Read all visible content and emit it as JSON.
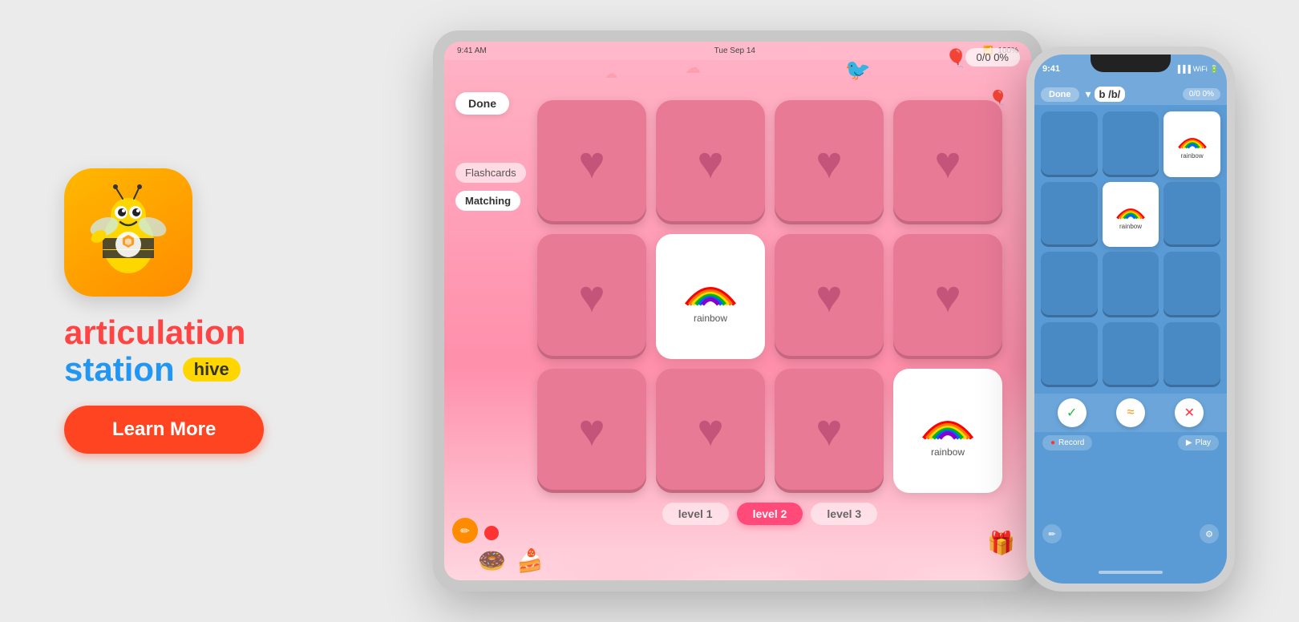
{
  "background_color": "#ebebeb",
  "left": {
    "app_icon_alt": "Articulation Station Hive App Icon",
    "title_line1": "articulation",
    "title_line2_word1": "station",
    "hive_label": "hive",
    "learn_more_label": "Learn More"
  },
  "tablet": {
    "status_bar": {
      "time": "9:41 AM",
      "date": "Tue Sep 14",
      "wifi": "WiFi",
      "battery": "100%"
    },
    "done_button": "Done",
    "flashcards_button": "Flashcards",
    "matching_button": "Matching",
    "score": "0/0  0%",
    "card_label": "rainbow",
    "levels": [
      "level 1",
      "level 2",
      "level 3"
    ],
    "active_level": 1
  },
  "phone": {
    "time": "9:41",
    "signal": "signal",
    "wifi": "wifi",
    "battery": "battery",
    "done_button": "Done",
    "letter_label": "b /b/",
    "score": "0/0  0%",
    "card_label": "rainbow",
    "check_icon": "✓",
    "approx_icon": "≈",
    "x_icon": "✕",
    "record_label": "Record",
    "play_label": "Play"
  }
}
